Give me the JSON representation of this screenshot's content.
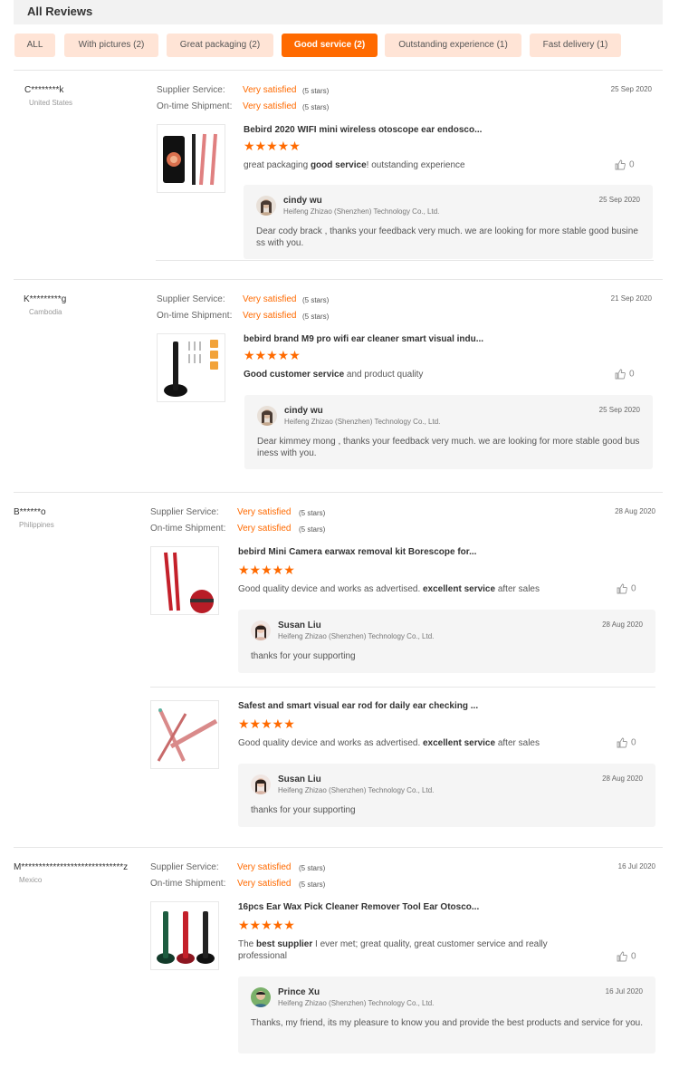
{
  "header": {
    "title": "All Reviews"
  },
  "filters": [
    {
      "label": "ALL",
      "active": false
    },
    {
      "label": "With pictures (2)",
      "active": false
    },
    {
      "label": "Great packaging (2)",
      "active": false
    },
    {
      "label": "Good service (2)",
      "active": true
    },
    {
      "label": "Outstanding experience (1)",
      "active": false
    },
    {
      "label": "Fast delivery (1)",
      "active": false
    }
  ],
  "labels": {
    "supplier_service": "Supplier Service:",
    "ontime_shipment": "On-time Shipment:",
    "very_satisfied": "Very satisfied",
    "five_stars": "(5 stars)",
    "stars_glyph": "★★★★★"
  },
  "reviews": [
    {
      "name": "C********k",
      "country": "United States",
      "date": "25 Sep 2020",
      "items": [
        {
          "title": "Bebird 2020 WIFI mini wireless otoscope ear endosco...",
          "comment_parts": [
            "great packaging ",
            "good service",
            "! outstanding experience"
          ],
          "likes": "0",
          "reply": {
            "name": "cindy wu",
            "company": "Heifeng Zhizao (Shenzhen) Technology Co., Ltd.",
            "date": "25 Sep 2020",
            "text": "Dear cody brack , thanks your feedback very much. we are looking for more stable good business with you."
          }
        }
      ]
    },
    {
      "name": "K*********g",
      "country": "Cambodia",
      "date": "21 Sep 2020",
      "items": [
        {
          "title": "bebird brand M9 pro wifi ear cleaner smart visual indu...",
          "comment_parts": [
            "",
            "Good customer service",
            " and product quality"
          ],
          "likes": "0",
          "reply": {
            "name": "cindy wu",
            "company": "Heifeng Zhizao (Shenzhen) Technology Co., Ltd.",
            "date": "25 Sep 2020",
            "text": "Dear kimmey mong , thanks your feedback very much. we are looking for more stable good business with you."
          }
        }
      ]
    },
    {
      "name": "B******o",
      "country": "Philippines",
      "date": "28 Aug 2020",
      "items": [
        {
          "title": "bebird Mini Camera earwax removal kit Borescope for...",
          "comment_parts": [
            "Good quality device and works as advertised. ",
            "excellent service",
            " after sales"
          ],
          "likes": "0",
          "reply": {
            "name": "Susan Liu",
            "company": "Heifeng Zhizao (Shenzhen) Technology Co., Ltd.",
            "date": "28 Aug 2020",
            "text": "thanks for your supporting"
          }
        },
        {
          "title": "Safest and smart visual ear rod for daily ear checking ...",
          "comment_parts": [
            "Good quality device and works as advertised. ",
            "excellent service",
            " after sales"
          ],
          "likes": "0",
          "reply": {
            "name": "Susan Liu",
            "company": "Heifeng Zhizao (Shenzhen) Technology Co., Ltd.",
            "date": "28 Aug 2020",
            "text": "thanks for your supporting"
          }
        }
      ]
    },
    {
      "name": "M*****************************z",
      "country": "Mexico",
      "date": "16 Jul 2020",
      "items": [
        {
          "title": "16pcs Ear Wax Pick Cleaner Remover Tool Ear Otosco...",
          "comment_parts": [
            "The ",
            "best supplier",
            " I ever met; great quality, great customer service and really professional"
          ],
          "likes": "0",
          "reply": {
            "name": "Prince Xu",
            "company": "Heifeng Zhizao (Shenzhen) Technology Co., Ltd.",
            "date": "16 Jul 2020",
            "text": "Thanks, my friend, its my pleasure to know you and provide the best products and service for you."
          }
        }
      ]
    }
  ]
}
